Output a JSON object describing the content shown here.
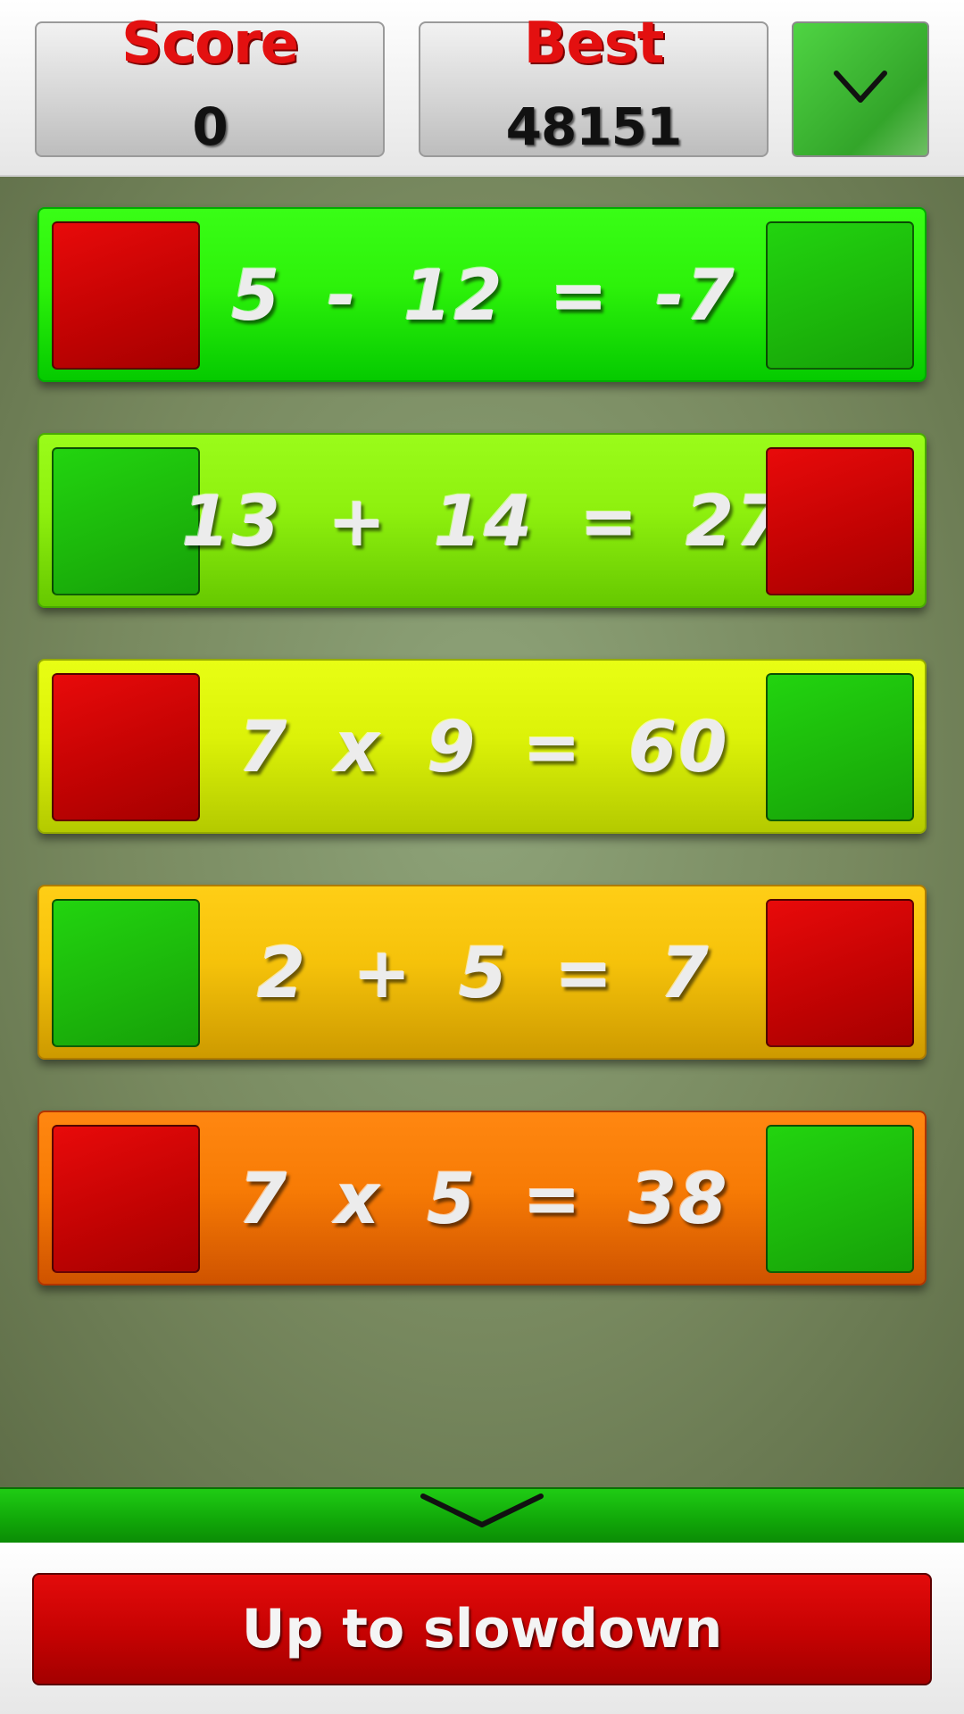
{
  "header": {
    "score_label": "Score",
    "score_value": "0",
    "best_label": "Best",
    "best_value": "48151",
    "menu_icon": "chevron-down-icon"
  },
  "rows": [
    {
      "equation": "5 - 12 = -7",
      "left_tile": "red",
      "right_tile": "green",
      "bar_color": "#2df20a"
    },
    {
      "equation": "13 + 14 = 27",
      "left_tile": "green",
      "right_tile": "red",
      "bar_color": "#8ef00e"
    },
    {
      "equation": "7 x 9 = 60",
      "left_tile": "red",
      "right_tile": "green",
      "bar_color": "#dcf208"
    },
    {
      "equation": "2 + 5 = 7",
      "left_tile": "green",
      "right_tile": "red",
      "bar_color": "#f5c20a"
    },
    {
      "equation": "7 x 5 = 38",
      "left_tile": "red",
      "right_tile": "green",
      "bar_color": "#f77b05"
    }
  ],
  "colors": {
    "red_tile": "#c40303",
    "green_tile": "#1cb80b",
    "label_red": "#e31010"
  },
  "footer": {
    "expand_icon": "chevron-down-icon",
    "slowdown_label": "Up to slowdown"
  }
}
